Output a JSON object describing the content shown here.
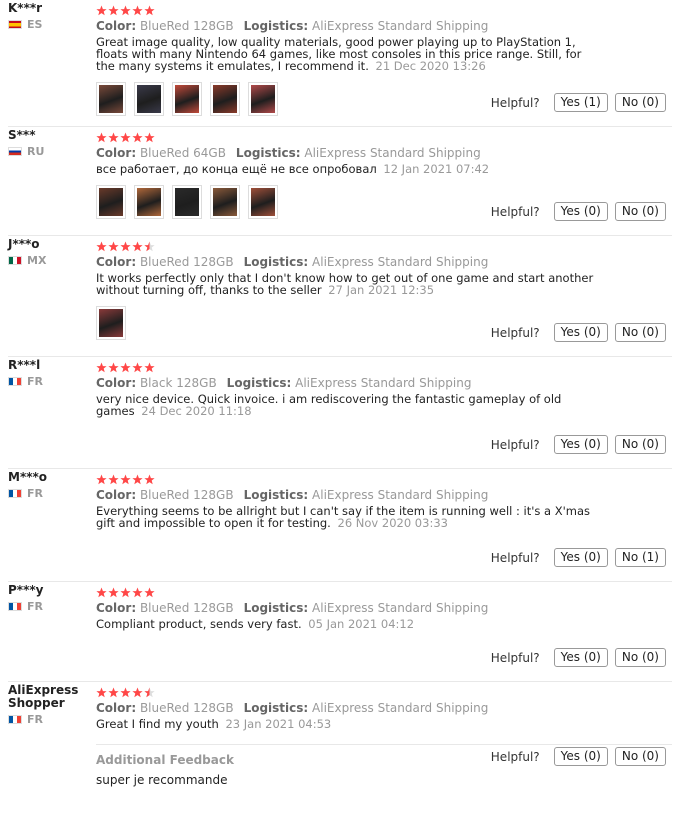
{
  "ui": {
    "color_label": "Color:",
    "logistics_label": "Logistics:",
    "helpful_label": "Helpful?",
    "star_color": "#ff4747",
    "star_empty": "#dddddd"
  },
  "reviews": [
    {
      "user": "K***r",
      "country": "ES",
      "flag": "es",
      "stars": 5,
      "color": "BlueRed 128GB",
      "logistics": "AliExpress Standard Shipping",
      "text": "Great image quality, low quality materials, good power playing up to PlayStation 1, floats with many Nintendo 64 games, like most consoles in this price range. Still, for the many systems it emulates, I recommend it.",
      "date": "21 Dec 2020 13:26",
      "photos": 5,
      "yes": "Yes (1)",
      "no": "No (0)"
    },
    {
      "user": "S***",
      "country": "RU",
      "flag": "ru",
      "stars": 5,
      "color": "BlueRed 64GB",
      "logistics": "AliExpress Standard Shipping",
      "text": "все работает, до конца ещё не все опробовал",
      "date": "12 Jan 2021 07:42",
      "photos": 5,
      "yes": "Yes (0)",
      "no": "No (0)"
    },
    {
      "user": "J***o",
      "country": "MX",
      "flag": "mx",
      "stars": 4.5,
      "color": "BlueRed 128GB",
      "logistics": "AliExpress Standard Shipping",
      "text": "It works perfectly only that I don't know how to get out of one game and start another without turning off, thanks to the seller",
      "date": "27 Jan 2021 12:35",
      "photos": 1,
      "yes": "Yes (0)",
      "no": "No (0)"
    },
    {
      "user": "R***l",
      "country": "FR",
      "flag": "fr",
      "stars": 5,
      "color": "Black 128GB",
      "logistics": "AliExpress Standard Shipping",
      "text": "very nice device. Quick invoice. i am rediscovering the fantastic gameplay of old games",
      "date": "24 Dec 2020 11:18",
      "photos": 0,
      "yes": "Yes (0)",
      "no": "No (0)"
    },
    {
      "user": "M***o",
      "country": "FR",
      "flag": "fr",
      "stars": 5,
      "color": "BlueRed 128GB",
      "logistics": "AliExpress Standard Shipping",
      "text": "Everything seems to be allright but I can't say if the item is running well : it's a X'mas gift and impossible to open it for testing.",
      "date": "26 Nov 2020 03:33",
      "photos": 0,
      "yes": "Yes (0)",
      "no": "No (1)"
    },
    {
      "user": "P***y",
      "country": "FR",
      "flag": "fr",
      "stars": 5,
      "color": "BlueRed 128GB",
      "logistics": "AliExpress Standard Shipping",
      "text": "Compliant product, sends very fast.",
      "date": "05 Jan 2021 04:12",
      "photos": 0,
      "yes": "Yes (0)",
      "no": "No (0)"
    },
    {
      "user": "AliExpress Shopper",
      "country": "FR",
      "flag": "fr",
      "stars": 4.5,
      "color": "BlueRed 128GB",
      "logistics": "AliExpress Standard Shipping",
      "text": "Great I find my youth",
      "date": "23 Jan 2021 04:53",
      "photos": 0,
      "yes": "Yes (0)",
      "no": "No (0)",
      "additional_title": "Additional Feedback",
      "additional_text": "super je recommande"
    }
  ]
}
